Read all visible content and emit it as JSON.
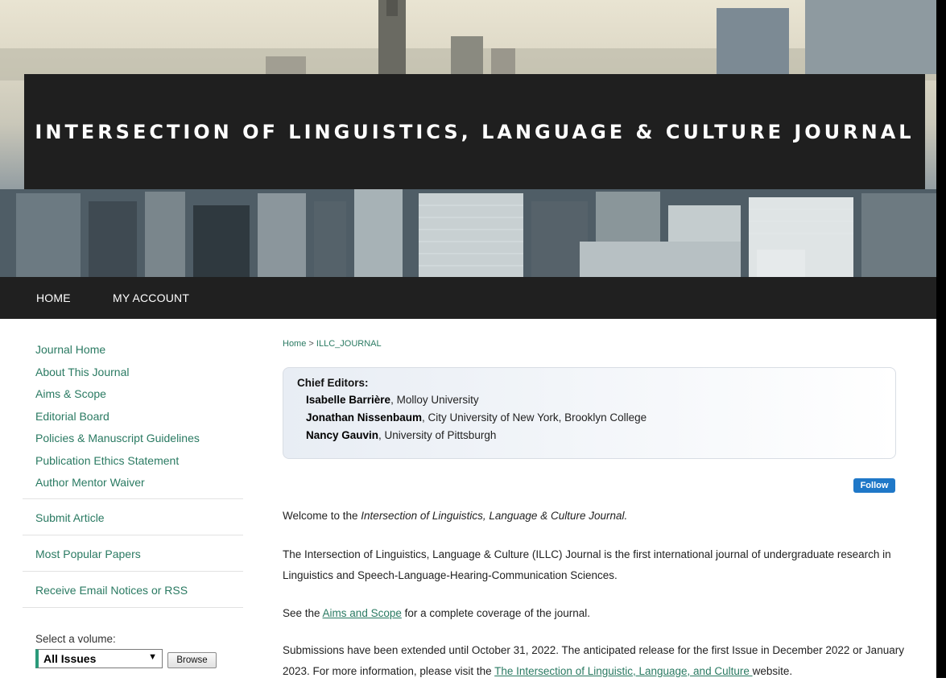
{
  "banner": {
    "title": "INTERSECTION OF LINGUISTICS, LANGUAGE & CULTURE JOURNAL"
  },
  "nav": {
    "home": "HOME",
    "account": "MY ACCOUNT"
  },
  "sidebar": {
    "links": [
      "Journal Home",
      "About This Journal",
      "Aims & Scope",
      "Editorial Board",
      "Policies & Manuscript Guidelines",
      "Publication Ethics Statement",
      "Author Mentor Waiver"
    ],
    "sections": [
      "Submit Article",
      "Most Popular Papers",
      "Receive Email Notices or RSS"
    ],
    "select_label": "Select a volume:",
    "select_value": "All Issues",
    "browse_label": "Browse"
  },
  "breadcrumb": {
    "home": "Home",
    "sep": ">",
    "current": "ILLC_JOURNAL"
  },
  "editors": {
    "title": "Chief Editors:",
    "people": [
      {
        "name": "Isabelle Barrière",
        "affiliation": ", Molloy University"
      },
      {
        "name": "Jonathan Nissenbaum",
        "affiliation": ", City University of New York, Brooklyn College"
      },
      {
        "name": "Nancy Gauvin",
        "affiliation": ", University of Pittsburgh"
      }
    ]
  },
  "follow_label": "Follow",
  "content": {
    "welcome_prefix": "Welcome to the ",
    "welcome_title": "Intersection of Linguistics, Language & Culture Journal.",
    "intro": "The Intersection of Linguistics, Language & Culture (ILLC) Journal is the first international journal of undergraduate research in Linguistics and Speech-Language-Hearing-Communication Sciences.",
    "see_prefix": "See the ",
    "see_link": "Aims and Scope",
    "see_suffix": " for a complete coverage of the journal.",
    "submissions_text": "Submissions have been extended until October 31, 2022. The anticipated release for the first Issue in December 2022 or January 2023. For more information, please visit the ",
    "submissions_link": "The Intersection of Linguistic, Language, and Culture ",
    "submissions_suffix": "website."
  }
}
